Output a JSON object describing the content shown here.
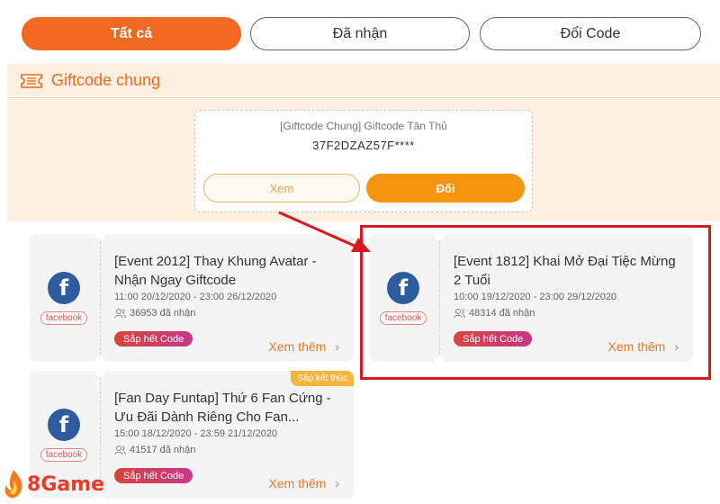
{
  "tabs": [
    {
      "label": "Tất cả",
      "active": true
    },
    {
      "label": "Đã nhận",
      "active": false
    },
    {
      "label": "Đổi Code",
      "active": false
    }
  ],
  "section": {
    "title": "Giftcode chung",
    "icon": "ticket-icon"
  },
  "featured": {
    "title": "[Giftcode Chung] Giftcode Tân Thủ",
    "code": "37F2DZAZ57F****",
    "view_label": "Xem",
    "exchange_label": "Đổi"
  },
  "cards": [
    {
      "source": "facebook",
      "title": "[Event 2012] Thay Khung Avatar - Nhận Ngay Giftcode",
      "time": "11:00 20/12/2020 - 23:00 26/12/2020",
      "count": "36953 đã nhận",
      "badge": "Sắp hết Code",
      "more": "Xem thêm"
    },
    {
      "source": "facebook",
      "title": "[Event 1812] Khai Mở Đại Tiệc Mừng 2 Tuổi",
      "time": "10:00 19/12/2020 - 23:00 29/12/2020",
      "count": "48314 đã nhận",
      "badge": "Sắp hết Code",
      "more": "Xem thêm"
    },
    {
      "source": "facebook",
      "corner_tag": "Sắp kết thúc",
      "title": "[Fan Day Funtap] Thứ 6 Fan Cứng - Ưu Đãi Dành Riêng Cho Fan...",
      "time": "15:00 18/12/2020 - 23:59 21/12/2020",
      "count": "41517 đã nhận",
      "badge": "Sắp hết Code",
      "more": "Xem thêm"
    }
  ],
  "logo": {
    "text": "Game",
    "mark": "8"
  },
  "colors": {
    "accent": "#f26a21",
    "highlight": "#d71920",
    "facebook": "#2f5b9f"
  }
}
